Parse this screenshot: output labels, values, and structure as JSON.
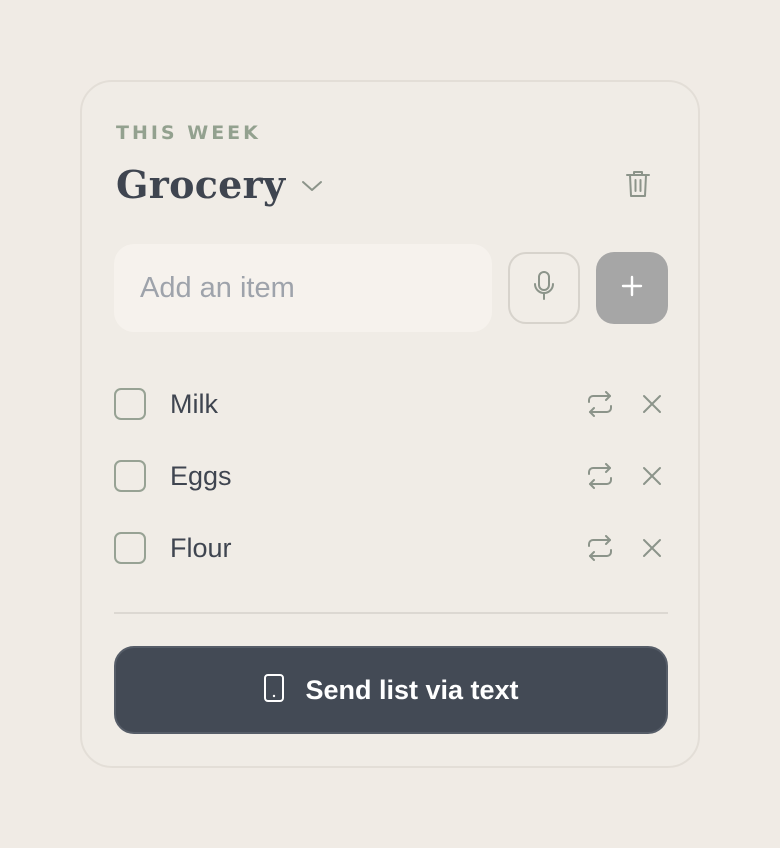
{
  "list": {
    "eyebrow": "THIS WEEK",
    "title": "Grocery"
  },
  "add_item": {
    "placeholder": "Add an item",
    "value": ""
  },
  "items": [
    {
      "label": "Milk",
      "checked": false
    },
    {
      "label": "Eggs",
      "checked": false
    },
    {
      "label": "Flour",
      "checked": false
    }
  ],
  "footer": {
    "send_label": "Send list via text"
  },
  "icons": {
    "title_dropdown": "chevron-down-icon",
    "delete_list": "trash-icon",
    "voice": "microphone-icon",
    "add": "plus-icon",
    "recurring": "repeat-icon",
    "remove": "close-icon",
    "send": "phone-icon"
  },
  "colors": {
    "background": "#f0ebe5",
    "accent": "#93a18f",
    "primary_text": "#3f4550",
    "send_button": "#434a55",
    "add_button_disabled": "#a6a6a6"
  }
}
